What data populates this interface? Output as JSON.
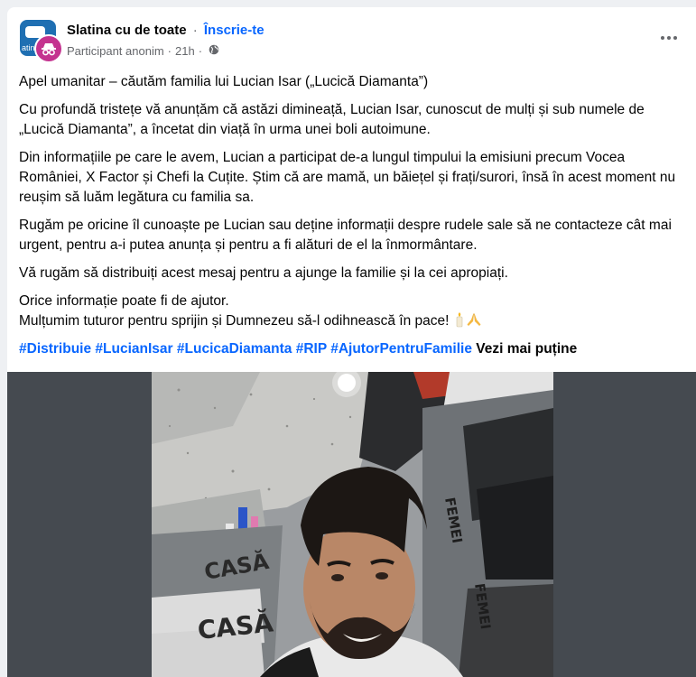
{
  "group": {
    "name": "Slatina cu de toate",
    "separator": "·",
    "join_label": "Înscrie-te",
    "avatar_text": "atin"
  },
  "post_meta": {
    "author": "Participant anonim",
    "separator": "·",
    "time": "21h"
  },
  "icons": {
    "group_avatar": "group-avatar-icon",
    "anonymous": "incognito-icon",
    "privacy": "globe-icon",
    "more": "more-options-icon",
    "emoji_candle": "candle-emoji-icon",
    "emoji_pray": "praying-hands-emoji-icon"
  },
  "body": {
    "title_line": "Apel umanitar – căutăm familia lui Lucian Isar („Lucică Diamanta”)",
    "p1": "Cu profundă tristețe vă anunțăm că astăzi dimineață, Lucian Isar, cunoscut de mulți și sub numele de „Lucică Diamanta”, a încetat din viață în urma unei boli autoimune.",
    "p2": "Din informațiile pe care le avem, Lucian a participat de-a lungul timpului la emisiuni precum Vocea României, X Factor și Chefi la Cuțite. Știm că are mamă, un băiețel și frați/surori, însă în acest moment nu reușim să luăm legătura cu familia sa.",
    "p3": "Rugăm pe oricine îl cunoaște pe Lucian sau deține informații despre rudele sale să ne contacteze cât mai urgent, pentru a-i putea anunța și pentru a fi alături de el la înmormântare.",
    "p4": "Vă rugăm să distribuiți acest mesaj pentru a ajunge la familie și la cei apropiați.",
    "p5_line1": "Orice informație poate fi de ajutor.",
    "p5_line2": "Mulțumim tuturor pentru sprijin și Dumnezeu să-l odihnească în pace!",
    "hashtags": [
      "#Distribuie",
      "#LucianIsar",
      "#LucicaDiamanta",
      "#RIP",
      "#AjutorPentruFamilie"
    ],
    "see_less": "Vezi mai puține"
  },
  "photo_signs": {
    "sign_left_top": "CASĂ",
    "sign_left_bottom": "CASĂ",
    "sign_right_top": "FEMEI",
    "sign_right_bottom": "FEMEI"
  },
  "colors": {
    "link_blue": "#0866ff",
    "secondary_text": "#65676b",
    "anon_badge": "#c4338f",
    "group_avatar": "#1f6fb2"
  }
}
